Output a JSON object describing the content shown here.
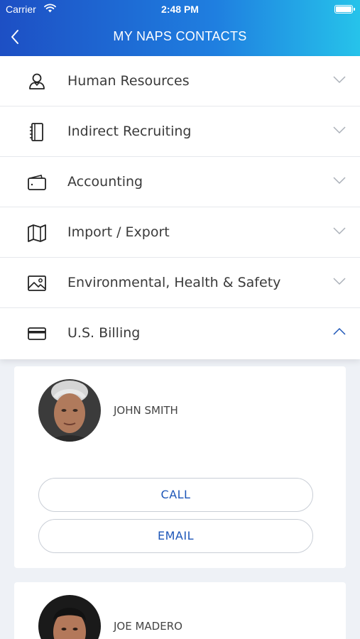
{
  "status_bar": {
    "carrier": "Carrier",
    "time": "2:48 PM"
  },
  "header": {
    "title": "MY NAPS CONTACTS"
  },
  "menu": {
    "items": [
      {
        "label": "Human Resources",
        "icon": "person-icon",
        "expanded": false
      },
      {
        "label": "Indirect Recruiting",
        "icon": "notebook-icon",
        "expanded": false
      },
      {
        "label": "Accounting",
        "icon": "wallet-icon",
        "expanded": false
      },
      {
        "label": "Import / Export",
        "icon": "map-icon",
        "expanded": false
      },
      {
        "label": "Environmental, Health & Safety",
        "icon": "image-icon",
        "expanded": false
      },
      {
        "label": "U.S. Billing",
        "icon": "credit-card-icon",
        "expanded": true
      }
    ]
  },
  "contacts": [
    {
      "name": "JOHN SMITH",
      "call_label": "CALL",
      "email_label": "EMAIL"
    },
    {
      "name": "JOE MADERO"
    }
  ],
  "colors": {
    "accent": "#1d56b8",
    "header_start": "#1d4fc4",
    "header_end": "#26c3ea"
  }
}
